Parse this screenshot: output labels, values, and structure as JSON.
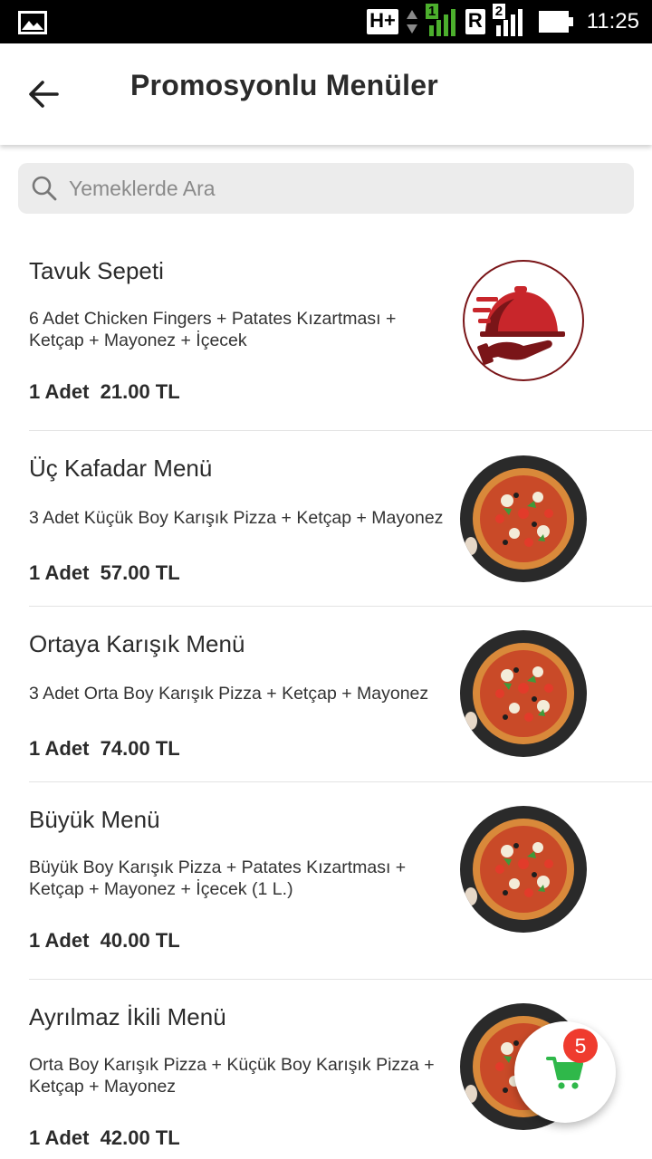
{
  "status_bar": {
    "network_type": "H+",
    "sim1_label": "1",
    "roaming_label": "R",
    "sim2_label": "2",
    "time": "11:25",
    "icons": [
      "gallery-icon",
      "network-arrows-icon",
      "signal-icon",
      "battery-icon"
    ]
  },
  "app_bar": {
    "title": "Promosyonlu Menüler",
    "back_icon": "arrow-left-icon"
  },
  "search": {
    "placeholder": "Yemeklerde Ara",
    "value": "",
    "icon": "search-icon"
  },
  "menu_items": [
    {
      "title": "Tavuk Sepeti",
      "description": "6 Adet Chicken Fingers + Patates Kızartması + Ketçap + Mayonez + İçecek",
      "price": "1 Adet  21.00 TL",
      "image": "serving-hand-logo"
    },
    {
      "title": "Üç Kafadar Menü",
      "description": "3 Adet Küçük Boy Karışık Pizza + Ketçap + Mayonez",
      "price": "1 Adet  57.00 TL",
      "image": "pizza-photo"
    },
    {
      "title": "Ortaya Karışık Menü",
      "description": "3 Adet Orta Boy Karışık Pizza + Ketçap + Mayonez",
      "price": "1 Adet  74.00 TL",
      "image": "pizza-photo"
    },
    {
      "title": "Büyük Menü",
      "description": "Büyük Boy Karışık Pizza + Patates Kızartması + Ketçap + Mayonez + İçecek (1 L.)",
      "price": "1 Adet  40.00 TL",
      "image": "pizza-photo"
    },
    {
      "title": "Ayrılmaz İkili Menü",
      "description": "Orta Boy Karışık Pizza + Küçük Boy Karışık Pizza + Ketçap + Mayonez",
      "price": "1 Adet  42.00 TL",
      "image": "pizza-photo"
    }
  ],
  "cart": {
    "count": "5",
    "icon": "shopping-cart-icon",
    "accent_color": "#2fb84a",
    "badge_color": "#ef3b2e"
  },
  "colors": {
    "logo_maroon": "#7a1518",
    "logo_red": "#c8262b"
  }
}
